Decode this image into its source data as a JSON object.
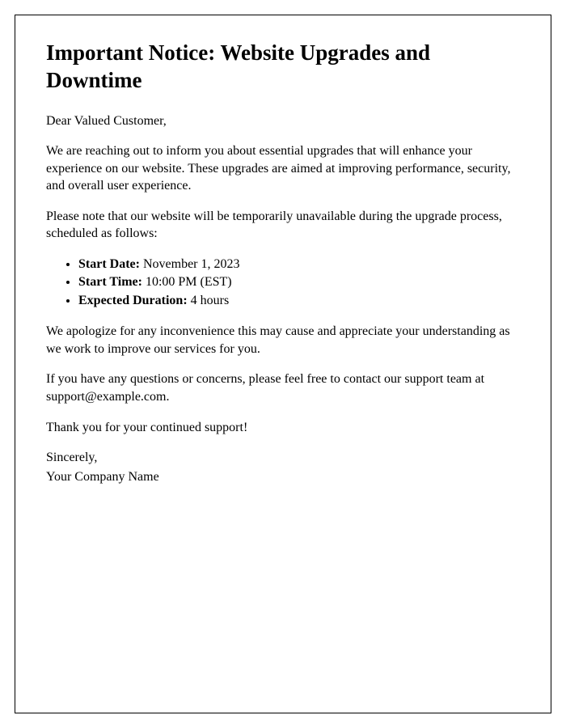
{
  "title": "Important Notice: Website Upgrades and Downtime",
  "greeting": "Dear Valued Customer,",
  "para1": "We are reaching out to inform you about essential upgrades that will enhance your experience on our website. These upgrades are aimed at improving performance, security, and overall user experience.",
  "para2": "Please note that our website will be temporarily unavailable during the upgrade process, scheduled as follows:",
  "schedule": [
    {
      "label": "Start Date:",
      "value": " November 1, 2023"
    },
    {
      "label": "Start Time:",
      "value": " 10:00 PM (EST)"
    },
    {
      "label": "Expected Duration:",
      "value": " 4 hours"
    }
  ],
  "para3": "We apologize for any inconvenience this may cause and appreciate your understanding as we work to improve our services for you.",
  "para4": "If you have any questions or concerns, please feel free to contact our support team at support@example.com.",
  "para5": "Thank you for your continued support!",
  "signoff": "Sincerely,",
  "company": "Your Company Name"
}
